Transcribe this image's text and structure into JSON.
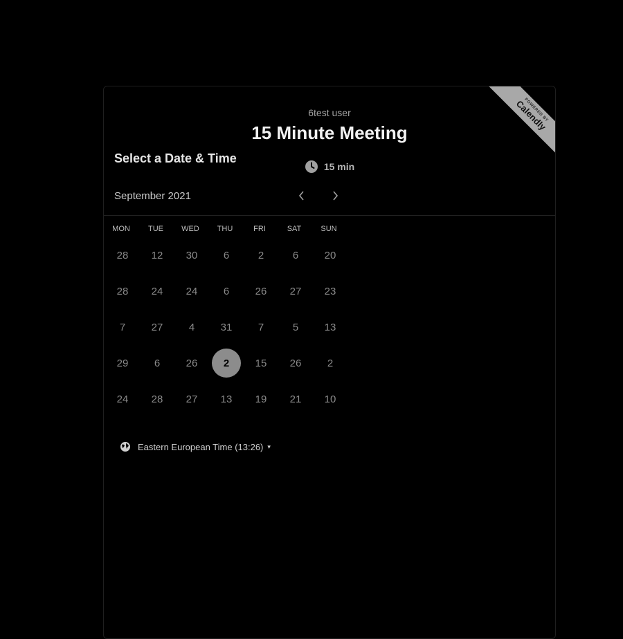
{
  "organizer": "6test user",
  "event_title": "15 Minute Meeting",
  "duration": {
    "icon": "clock-icon",
    "label": "15 min"
  },
  "ribbon": {
    "small": "POWERED BY",
    "brand": "Calendly"
  },
  "section_title": "Select a Date & Time",
  "calendar": {
    "month": "September 2021",
    "prev_icon": "chevron-left-icon",
    "next_icon": "chevron-right-icon",
    "weekdays": [
      "MON",
      "TUE",
      "WED",
      "THU",
      "FRI",
      "SAT",
      "SUN"
    ],
    "weeks": [
      [
        "28",
        "12",
        "30",
        "6",
        "2",
        "6",
        "20"
      ],
      [
        "28",
        "24",
        "24",
        "6",
        "26",
        "27",
        "23"
      ],
      [
        "7",
        "27",
        "4",
        "31",
        "7",
        "5",
        "13"
      ],
      [
        "29",
        "6",
        "26",
        "2",
        "15",
        "26",
        "2"
      ],
      [
        "24",
        "28",
        "27",
        "13",
        "19",
        "21",
        "10"
      ]
    ],
    "selected": {
      "week": 3,
      "day": 3
    }
  },
  "timezone": {
    "icon": "globe-icon",
    "label": "Eastern European Time (13:26)",
    "caret": "▾"
  }
}
